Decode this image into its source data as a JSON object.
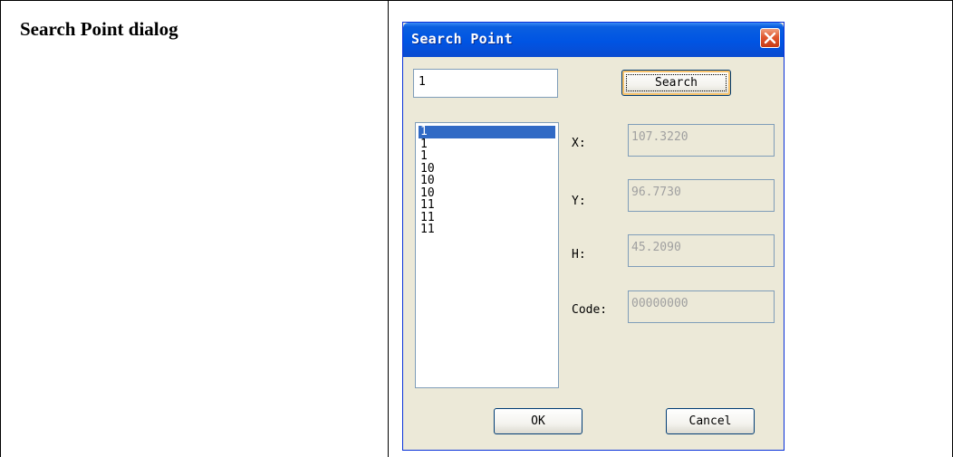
{
  "document": {
    "cell_title": "Search Point dialog"
  },
  "dialog": {
    "title": "Search Point",
    "search_value": "1",
    "search_button": "Search",
    "point_list": [
      "1",
      "1",
      "1",
      "10",
      "10",
      "10",
      "11",
      "11",
      "11"
    ],
    "selected_index": 0,
    "fields": {
      "x_label": "X:",
      "x_value": "107.3220",
      "y_label": "Y:",
      "y_value": "96.7730",
      "h_label": "H:",
      "h_value": "45.2090",
      "code_label": "Code:",
      "code_value": "00000000"
    },
    "ok_button": "OK",
    "cancel_button": "Cancel"
  },
  "colors": {
    "titlebar": "#0054e3",
    "dialog_face": "#ece9d8",
    "selection": "#316ac5",
    "close_button": "#e0572f"
  }
}
